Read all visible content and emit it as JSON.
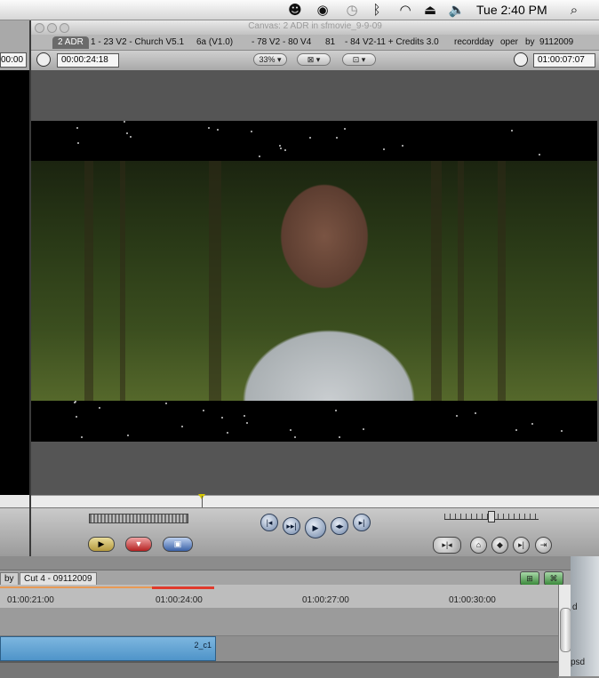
{
  "menubar": {
    "time": "Tue 2:40 PM",
    "icons": [
      "user-status-icon",
      "eye-icon",
      "time-machine-icon",
      "bluetooth-icon",
      "wifi-icon",
      "eject-icon",
      "volume-icon",
      "spotlight-icon"
    ]
  },
  "left_window": {
    "timecode": "00:00"
  },
  "canvas": {
    "title": "Canvas: 2 ADR in sfmovie_9-9-09",
    "tabs": [
      "2 ADR",
      "1 - 23 V2 - Church  V5.1",
      "6a (V1.0)",
      "- 78 V2 - 80 V4",
      "81",
      "- 84 V2-11 + Credits 3.0",
      "recordday",
      "oper",
      "by",
      "9112009"
    ],
    "duration_tc": "00:00:24:18",
    "current_tc": "01:00:07:07",
    "zoom": "33%",
    "playhead_fraction": 0.3
  },
  "transport": {
    "buttons": [
      "go-to-previous-edit",
      "play-in-to-out",
      "play",
      "play-around-current",
      "go-to-next-edit"
    ],
    "symbols": [
      "|◂",
      "▸▸|",
      "▶",
      "◂▸",
      "▸|"
    ]
  },
  "timeline": {
    "tabs": [
      "by",
      "Cut 4 - 09112009"
    ],
    "ruler": [
      "01:00:21:00",
      "01:00:24:00",
      "01:00:27:00",
      "01:00:30:00"
    ],
    "clip_name": "2_c1"
  },
  "desktop": {
    "labels": [
      "d",
      "psd"
    ]
  }
}
